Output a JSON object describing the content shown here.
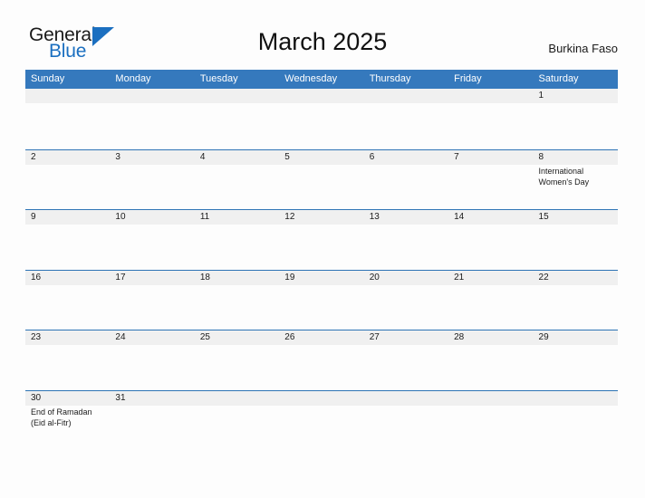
{
  "brand": {
    "name_part1": "General",
    "name_part2": "Blue",
    "flag_icon": "blue-triangle-flag-icon",
    "color_dark": "#1a1a1a",
    "color_accent": "#1b6fc0"
  },
  "header": {
    "title": "March 2025",
    "country": "Burkina Faso"
  },
  "theme": {
    "header_row_bg": "#3579bd",
    "row_divider": "#2e74b5",
    "day_band_bg": "#f0f0f0",
    "page_bg": "#fdfdfd",
    "text": "#1a1a1a"
  },
  "weekdays": [
    "Sunday",
    "Monday",
    "Tuesday",
    "Wednesday",
    "Thursday",
    "Friday",
    "Saturday"
  ],
  "weeks": [
    [
      {
        "day": ""
      },
      {
        "day": ""
      },
      {
        "day": ""
      },
      {
        "day": ""
      },
      {
        "day": ""
      },
      {
        "day": ""
      },
      {
        "day": "1"
      }
    ],
    [
      {
        "day": "2"
      },
      {
        "day": "3"
      },
      {
        "day": "4"
      },
      {
        "day": "5"
      },
      {
        "day": "6"
      },
      {
        "day": "7"
      },
      {
        "day": "8",
        "events": [
          "International",
          "Women's Day"
        ]
      }
    ],
    [
      {
        "day": "9"
      },
      {
        "day": "10"
      },
      {
        "day": "11"
      },
      {
        "day": "12"
      },
      {
        "day": "13"
      },
      {
        "day": "14"
      },
      {
        "day": "15"
      }
    ],
    [
      {
        "day": "16"
      },
      {
        "day": "17"
      },
      {
        "day": "18"
      },
      {
        "day": "19"
      },
      {
        "day": "20"
      },
      {
        "day": "21"
      },
      {
        "day": "22"
      }
    ],
    [
      {
        "day": "23"
      },
      {
        "day": "24"
      },
      {
        "day": "25"
      },
      {
        "day": "26"
      },
      {
        "day": "27"
      },
      {
        "day": "28"
      },
      {
        "day": "29"
      }
    ],
    [
      {
        "day": "30",
        "events": [
          "End of Ramadan",
          "(Eid al-Fitr)"
        ]
      },
      {
        "day": "31"
      },
      {
        "day": ""
      },
      {
        "day": ""
      },
      {
        "day": ""
      },
      {
        "day": ""
      },
      {
        "day": ""
      }
    ]
  ]
}
